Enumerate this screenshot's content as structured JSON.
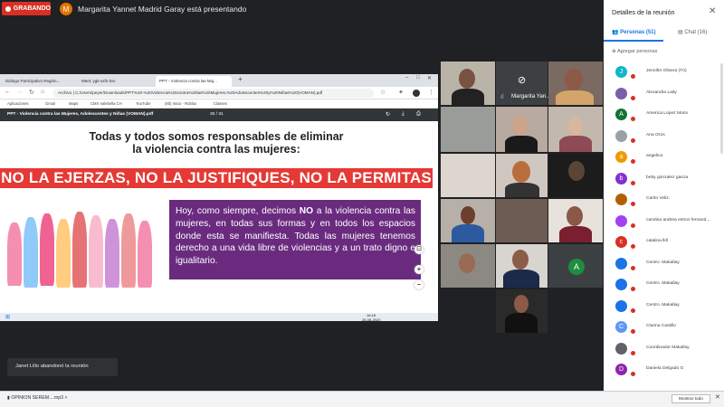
{
  "meeting": {
    "recording_label": "GRABANDO",
    "presenter_initial": "M",
    "presenting_text": "Margarita Yannet Madrid Garay está presentando",
    "tile_name": "Margarita Yan...",
    "tile_avatar": "A"
  },
  "browser": {
    "tabs": [
      "Diálogo Participativo Región...",
      "Meet: ygk-xxfn-kxv",
      "PPT - Violencia contra las Muj..."
    ],
    "url": "Archivo | C:/Users/peyer/Downloads/PPT%20-%20Violencia%20contra%20las%20Mujeres,%20Adolescentes%20y%20Niñas%20(VOMAN).pdf",
    "bookmarks": [
      "Aplicaciones",
      "Gmail",
      "Maps",
      "CMX Valebella CH",
      "YouTube",
      "(80) Inicio - Roblox",
      "Classes"
    ],
    "pdf_title": "PPT - Violencia contra las Mujeres, Adolescentes y Niñas (VOMAN).pdf",
    "page_indicator": "30 / 31",
    "taskbar_time": "16:18",
    "taskbar_date": "28-08-2020"
  },
  "slide": {
    "title_line1": "Todas y todos somos responsables de eliminar",
    "title_line2": "la violencia contra las mujeres:",
    "banner": "NO LA EJERZAS, NO LA JUSTIFIQUES, NO LA PERMITAS",
    "body_before": "Hoy, como siempre, decimos ",
    "body_bold": "NO",
    "body_after": " a la violencia contra las mujeres, en todas sus formas y en todos los espacios donde esta se manifiesta. Todas las mujeres tenemos derecho a una vida libre de violencias y a un trato digno e igualitario."
  },
  "panel": {
    "title": "Detalles de la reunión",
    "people_tab": "Personas (51)",
    "chat_tab": "Chat (16)",
    "add_people": "Agregar personas",
    "people": [
      {
        "initial": "J",
        "name": "Jennifer Olivera (Tú)",
        "color": "#12b5cb"
      },
      {
        "initial": "",
        "name": "Alexandra Laity",
        "color": "#7b5ea7"
      },
      {
        "initial": "A",
        "name": "America Lopez Moris",
        "color": "#137333"
      },
      {
        "initial": "",
        "name": "Ana Oros",
        "color": "#9aa0a6"
      },
      {
        "initial": "a",
        "name": "angelica",
        "color": "#f29900"
      },
      {
        "initial": "b",
        "name": "betty gonzalez garcia",
        "color": "#8430ce"
      },
      {
        "initial": "",
        "name": "Carito Veliz.",
        "color": "#b06000"
      },
      {
        "initial": "",
        "name": "carolina andrea estroz fernand...",
        "color": "#a142f4"
      },
      {
        "initial": "c",
        "name": "catalina lkll",
        "color": "#d93025"
      },
      {
        "initial": "",
        "name": "Centro .Makallay",
        "color": "#1a73e8"
      },
      {
        "initial": "",
        "name": "Centro .Makallay",
        "color": "#1a73e8"
      },
      {
        "initial": "",
        "name": "Centro .Makallay",
        "color": "#1a73e8"
      },
      {
        "initial": "C",
        "name": "Clarina Castillo",
        "color": "#5e97f6"
      },
      {
        "initial": "",
        "name": "Coordinador Makallay",
        "color": "#5f6368"
      },
      {
        "initial": "D",
        "name": "Daniela Delgado G",
        "color": "#8e24aa"
      }
    ]
  },
  "toast": "Janet Lillo abandonó la reunión",
  "download": {
    "file": "OPINION SEREM....mp3",
    "show_all": "Mostrar todo"
  }
}
